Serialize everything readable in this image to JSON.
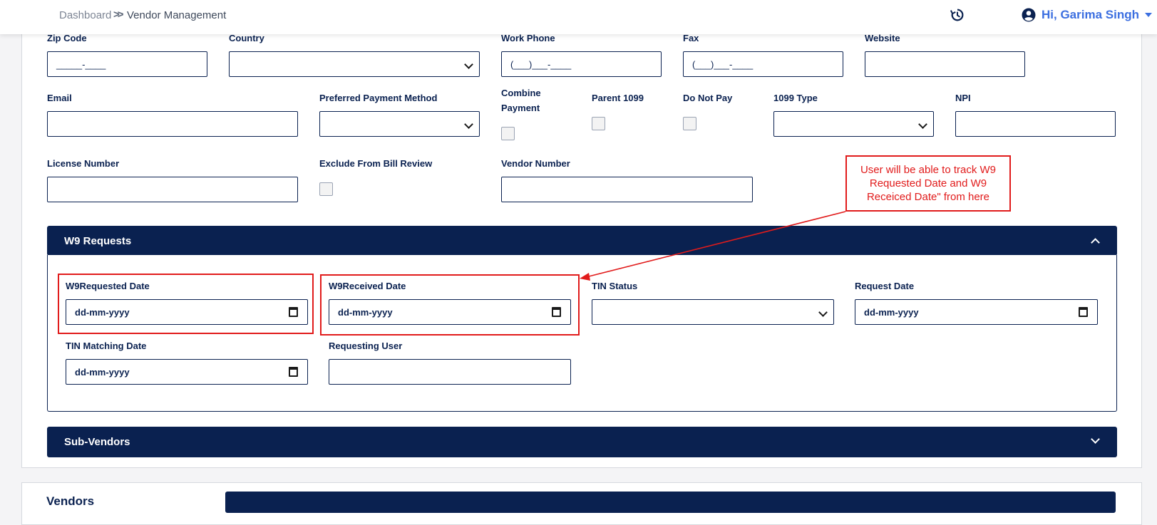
{
  "header": {
    "breadcrumb_home": "Dashboard",
    "breadcrumb_sep": "»",
    "breadcrumb_current": "Vendor Management",
    "history_icon": "history-icon",
    "user_icon": "user-circle-icon",
    "user_greeting": "Hi, Garima Singh",
    "accent_color": "#3c6fe0"
  },
  "form": {
    "zip_code": {
      "label": "Zip Code",
      "value": "_____-____"
    },
    "country": {
      "label": "Country",
      "value": ""
    },
    "work_phone": {
      "label": "Work Phone",
      "value": "(___)___-____"
    },
    "fax": {
      "label": "Fax",
      "value": "(___)___-____"
    },
    "website": {
      "label": "Website",
      "value": ""
    },
    "email": {
      "label": "Email",
      "value": ""
    },
    "preferred_payment_method": {
      "label": "Preferred Payment Method",
      "value": ""
    },
    "combine_payment": {
      "label_line1": "Combine",
      "label_line2": "Payment",
      "checked": false
    },
    "parent_1099": {
      "label": "Parent 1099",
      "checked": false
    },
    "do_not_pay": {
      "label": "Do Not Pay",
      "checked": false
    },
    "type_1099": {
      "label": "1099 Type",
      "value": ""
    },
    "npi": {
      "label": "NPI",
      "value": ""
    },
    "license_number": {
      "label": "License Number",
      "value": ""
    },
    "exclude_from_bill_review": {
      "label": "Exclude From Bill Review",
      "checked": false
    },
    "vendor_number": {
      "label": "Vendor Number",
      "value": ""
    }
  },
  "w9_panel": {
    "title": "W9 Requests",
    "expanded": true,
    "w9_requested_date": {
      "label": "W9Requested Date",
      "value": "dd-mm-yyyy"
    },
    "w9_received_date": {
      "label": "W9Received Date",
      "value": "dd-mm-yyyy"
    },
    "tin_status": {
      "label": "TIN Status",
      "value": ""
    },
    "request_date": {
      "label": "Request Date",
      "value": "dd-mm-yyyy"
    },
    "tin_matching_date": {
      "label": "TIN Matching Date",
      "value": "dd-mm-yyyy"
    },
    "requesting_user": {
      "label": "Requesting User",
      "value": ""
    }
  },
  "annotation": {
    "text_line1": "User will be able to track W9",
    "text_line2": "Requested Date and W9",
    "text_line3": "Receiced Date\" from here",
    "color": "#e11b1b"
  },
  "sub_vendors_panel": {
    "title": "Sub-Vendors",
    "expanded": false
  },
  "vendors_section": {
    "title": "Vendors"
  },
  "theme": {
    "navy": "#0a2150"
  }
}
